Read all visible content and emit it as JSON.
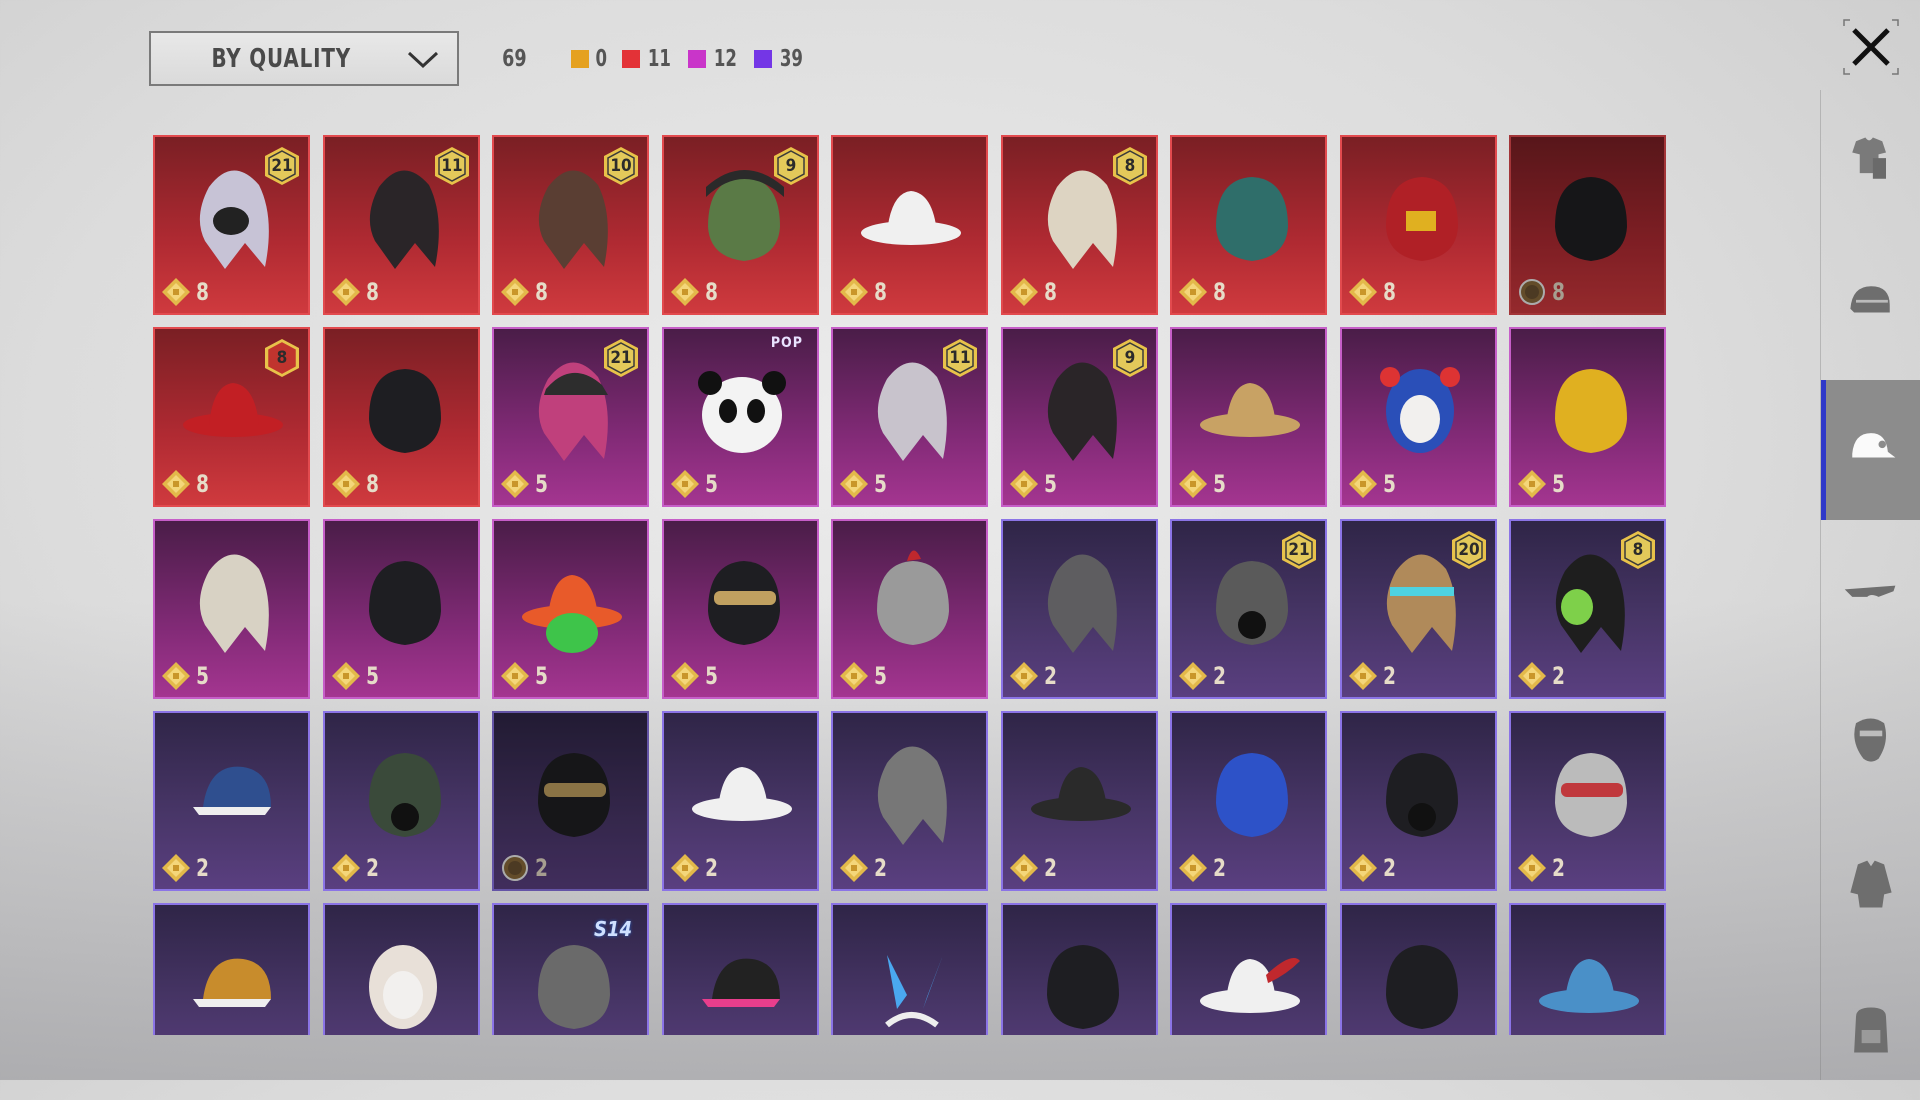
{
  "filter": {
    "label": "BY QUALITY"
  },
  "counts": {
    "total": "69",
    "quality": [
      {
        "color": "#e5a11f",
        "value": "0"
      },
      {
        "color": "#e33237",
        "value": "11"
      },
      {
        "color": "#c935c9",
        "value": "12"
      },
      {
        "color": "#7436e6",
        "value": "39"
      }
    ]
  },
  "items": [
    {
      "quality": "red",
      "badge": "21",
      "price": "8",
      "icon": "hair-silver-mask-icon"
    },
    {
      "quality": "red",
      "badge": "11",
      "price": "8",
      "icon": "hair-black-icon"
    },
    {
      "quality": "red",
      "badge": "10",
      "price": "8",
      "icon": "hair-brown-icon"
    },
    {
      "quality": "red",
      "badge": "9",
      "price": "8",
      "icon": "zombie-head-icon"
    },
    {
      "quality": "red",
      "badge": "",
      "price": "8",
      "icon": "white-cowboy-hat-icon"
    },
    {
      "quality": "red",
      "badge": "8",
      "price": "8",
      "icon": "hair-blonde-icon"
    },
    {
      "quality": "red",
      "badge": "",
      "price": "8",
      "icon": "teal-helmet-icon"
    },
    {
      "quality": "red",
      "badge": "",
      "price": "8",
      "icon": "red-robot-helmet-icon"
    },
    {
      "quality": "red",
      "badge": "",
      "price": "8",
      "icon": "black-cat-helmet-icon",
      "dark": true,
      "coin": "bronze"
    },
    {
      "quality": "red",
      "badge": "8",
      "price": "8",
      "icon": "red-pirate-hat-icon",
      "badgeStyle": "red"
    },
    {
      "quality": "red",
      "badge": "",
      "price": "8",
      "icon": "dark-hood-helmet-icon"
    },
    {
      "quality": "pink",
      "badge": "21",
      "price": "5",
      "icon": "pink-hair-cap-icon"
    },
    {
      "quality": "pink",
      "badge": "",
      "price": "5",
      "icon": "panda-head-icon",
      "pop": "POP"
    },
    {
      "quality": "pink",
      "badge": "11",
      "price": "5",
      "icon": "flower-hair-icon"
    },
    {
      "quality": "pink",
      "badge": "9",
      "price": "5",
      "icon": "long-dark-hair-icon"
    },
    {
      "quality": "pink",
      "badge": "",
      "price": "5",
      "icon": "straw-hat-icon"
    },
    {
      "quality": "pink",
      "badge": "",
      "price": "5",
      "icon": "jester-mask-icon"
    },
    {
      "quality": "pink",
      "badge": "",
      "price": "5",
      "icon": "yellow-helmet-icon"
    },
    {
      "quality": "pink",
      "badge": "",
      "price": "5",
      "icon": "lion-dreadlocks-icon"
    },
    {
      "quality": "pink",
      "badge": "",
      "price": "5",
      "icon": "black-bandana-icon"
    },
    {
      "quality": "pink",
      "badge": "",
      "price": "5",
      "icon": "frog-hat-icon"
    },
    {
      "quality": "pink",
      "badge": "",
      "price": "5",
      "icon": "visor-helmet-icon"
    },
    {
      "quality": "pink",
      "badge": "",
      "price": "5",
      "icon": "rooster-helmet-icon"
    },
    {
      "quality": "purple",
      "badge": "",
      "price": "2",
      "icon": "gray-hair-icon"
    },
    {
      "quality": "purple",
      "badge": "21",
      "price": "2",
      "icon": "skull-gasmask-icon"
    },
    {
      "quality": "purple",
      "badge": "20",
      "price": "2",
      "icon": "headband-hair-icon"
    },
    {
      "quality": "purple",
      "badge": "8",
      "price": "2",
      "icon": "green-skull-hair-icon"
    },
    {
      "quality": "purple",
      "badge": "",
      "price": "2",
      "icon": "world-cap-icon"
    },
    {
      "quality": "purple",
      "badge": "",
      "price": "2",
      "icon": "green-gasmask-icon"
    },
    {
      "quality": "purple",
      "badge": "",
      "price": "2",
      "icon": "black-visor-helmet-icon",
      "dark": true,
      "coin": "bronze"
    },
    {
      "quality": "purple",
      "badge": "",
      "price": "2",
      "icon": "white-sunhat-icon"
    },
    {
      "quality": "purple",
      "badge": "",
      "price": "2",
      "icon": "bucket-hat-red-hair-icon"
    },
    {
      "quality": "purple",
      "badge": "",
      "price": "2",
      "icon": "witch-hat-icon"
    },
    {
      "quality": "purple",
      "badge": "",
      "price": "2",
      "icon": "cricket-helmet-icon"
    },
    {
      "quality": "purple",
      "badge": "",
      "price": "2",
      "icon": "black-gasmask-icon"
    },
    {
      "quality": "purple",
      "badge": "",
      "price": "2",
      "icon": "goggles-icon"
    },
    {
      "quality": "purple",
      "badge": "",
      "price": "",
      "icon": "beanie-icon"
    },
    {
      "quality": "purple",
      "badge": "",
      "price": "",
      "icon": "oni-mask-icon"
    },
    {
      "quality": "purple",
      "badge": "",
      "price": "",
      "icon": "knight-helmet-icon",
      "season": "S14"
    },
    {
      "quality": "purple",
      "badge": "",
      "price": "",
      "icon": "pink-cap-icon"
    },
    {
      "quality": "purple",
      "badge": "",
      "price": "",
      "icon": "bunny-ears-icon"
    },
    {
      "quality": "purple",
      "badge": "",
      "price": "",
      "icon": "brown-fedora-icon"
    },
    {
      "quality": "purple",
      "badge": "",
      "price": "",
      "icon": "feather-hat-icon"
    },
    {
      "quality": "purple",
      "badge": "",
      "price": "",
      "icon": "black-mask-helmet-icon"
    },
    {
      "quality": "purple",
      "badge": "",
      "price": "",
      "icon": "shark-hat-icon"
    }
  ],
  "sidebar": [
    {
      "icon": "outfit-icon",
      "active": false
    },
    {
      "icon": "helmet-icon",
      "active": false
    },
    {
      "icon": "cap-icon",
      "active": true
    },
    {
      "icon": "glasses-icon",
      "active": false
    },
    {
      "icon": "face-mask-icon",
      "active": false
    },
    {
      "icon": "jacket-icon",
      "active": false
    },
    {
      "icon": "backpack-icon",
      "active": false
    }
  ]
}
